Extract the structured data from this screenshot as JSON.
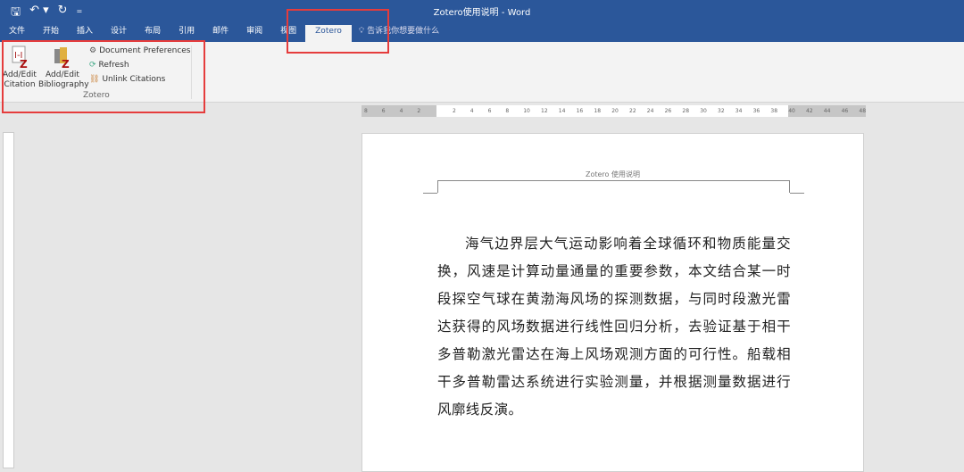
{
  "window": {
    "title": "Zotero使用说明  -  Word"
  },
  "qat": {
    "save": "🖫",
    "undo": "↶ ▾",
    "redo": "↻",
    "customize": "₌"
  },
  "tabs": [
    "文件",
    "开始",
    "插入",
    "设计",
    "布局",
    "引用",
    "邮件",
    "审阅",
    "视图",
    "Zotero"
  ],
  "tell_me": "告诉我你想要做什么",
  "ribbon": {
    "add_edit_citation": "Add/Edit Citation",
    "add_edit_bibliography": "Add/Edit Bibliography",
    "document_preferences": "Document Preferences",
    "refresh": "Refresh",
    "unlink_citations": "Unlink Citations",
    "group_label": "Zotero"
  },
  "ruler_ticks": [
    "8",
    "6",
    "4",
    "2",
    "",
    "2",
    "4",
    "6",
    "8",
    "10",
    "12",
    "14",
    "16",
    "18",
    "20",
    "22",
    "24",
    "26",
    "28",
    "30",
    "32",
    "34",
    "36",
    "38",
    "40",
    "42",
    "44",
    "46",
    "48"
  ],
  "document": {
    "header": "Zotero 使用说明",
    "paragraph": "海气边界层大气运动影响着全球循环和物质能量交换，风速是计算动量通量的重要参数，本文结合某一时段探空气球在黄渤海风场的探测数据，与同时段激光雷达获得的风场数据进行线性回归分析，去验证基于相干多普勒激光雷达在海上风场观测方面的可行性。船载相干多普勒雷达系统进行实验测量，并根据测量数据进行风廓线反演。"
  }
}
